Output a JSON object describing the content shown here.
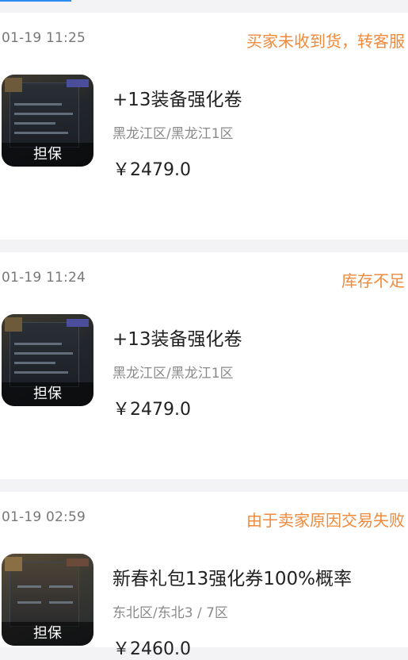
{
  "orders": [
    {
      "time": "01-19 11:25",
      "status": "买家未收到货，转客服",
      "title": "+13装备强化卷",
      "server": "黑龙江区/黑龙江1区",
      "price": "￥2479.0",
      "badge": "担保",
      "thumb_icon": "game-screenshot-icon"
    },
    {
      "time": "01-19 11:24",
      "status": "库存不足",
      "title": "+13装备强化卷",
      "server": "黑龙江区/黑龙江1区",
      "price": "￥2479.0",
      "badge": "担保",
      "thumb_icon": "game-screenshot-icon"
    },
    {
      "time": "01-19 02:59",
      "status": "由于卖家原因交易失败",
      "title": "新春礼包13强化券100%概率",
      "server": "东北区/东北3 / 7区",
      "price": "￥2460.0",
      "badge": "担保",
      "thumb_icon": "game-screenshot-icon"
    }
  ],
  "colors": {
    "status": "#f08a3c",
    "background": "#f3f3f5",
    "card": "#ffffff",
    "tab_accent": "#2b8cf0"
  }
}
